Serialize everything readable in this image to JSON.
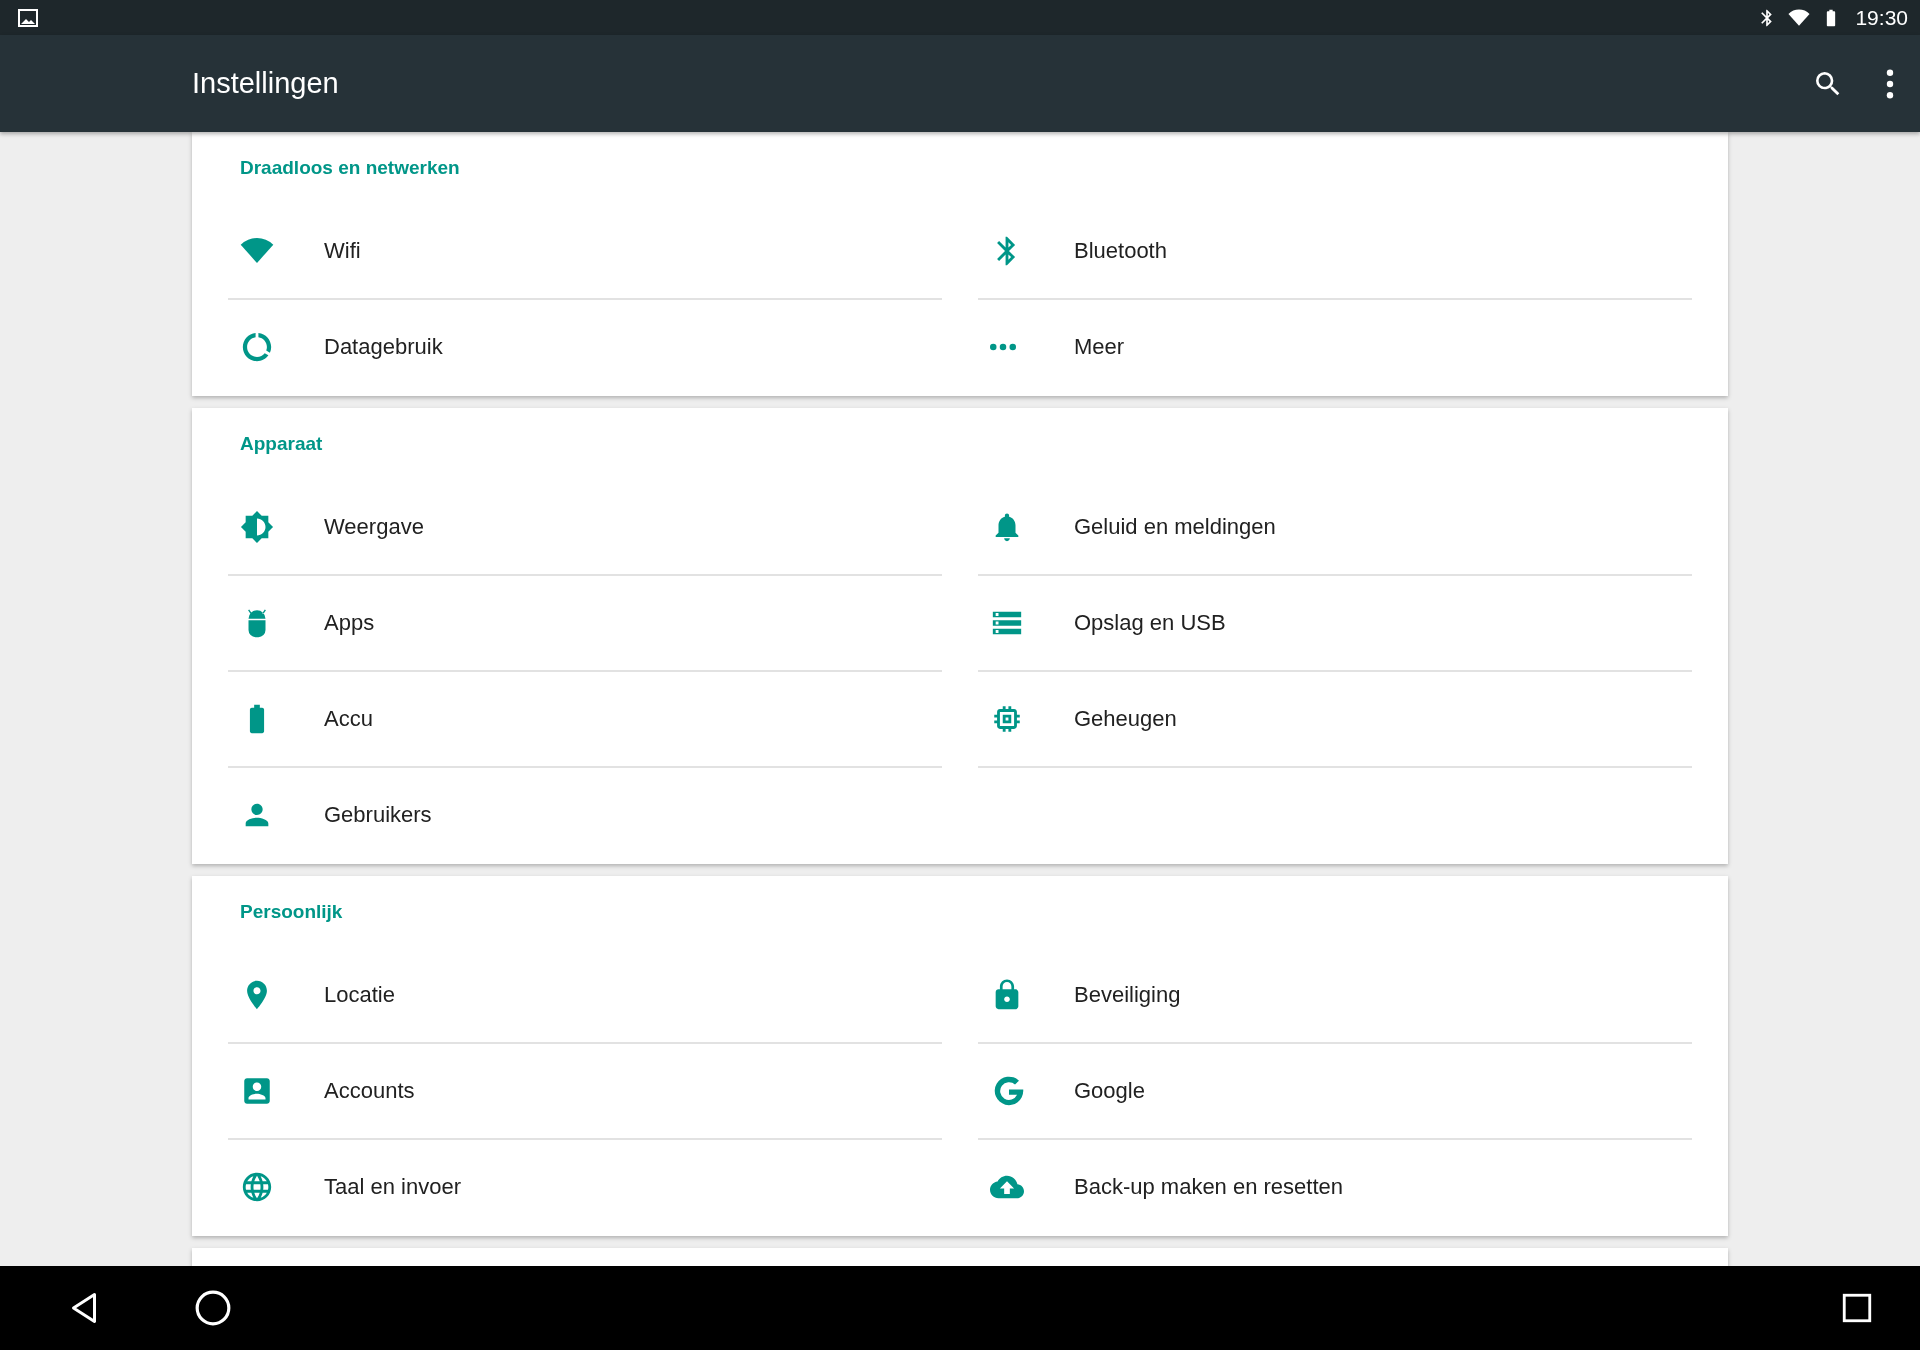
{
  "status_bar": {
    "time": "19:30"
  },
  "app_bar": {
    "title": "Instellingen"
  },
  "sections": [
    {
      "title": "Draadloos en netwerken",
      "items": [
        {
          "label": "Wifi",
          "kind": "wifi"
        },
        {
          "label": "Bluetooth",
          "kind": "bluetooth"
        },
        {
          "label": "Datagebruik",
          "kind": "data"
        },
        {
          "label": "Meer",
          "kind": "more"
        }
      ]
    },
    {
      "title": "Apparaat",
      "items": [
        {
          "label": "Weergave",
          "kind": "display"
        },
        {
          "label": "Geluid en meldingen",
          "kind": "sound"
        },
        {
          "label": "Apps",
          "kind": "apps"
        },
        {
          "label": "Opslag en USB",
          "kind": "storage"
        },
        {
          "label": "Accu",
          "kind": "battery"
        },
        {
          "label": "Geheugen",
          "kind": "memory"
        },
        {
          "label": "Gebruikers",
          "kind": "users"
        }
      ]
    },
    {
      "title": "Persoonlijk",
      "items": [
        {
          "label": "Locatie",
          "kind": "location"
        },
        {
          "label": "Beveiliging",
          "kind": "security"
        },
        {
          "label": "Accounts",
          "kind": "accounts"
        },
        {
          "label": "Google",
          "kind": "google"
        },
        {
          "label": "Taal en invoer",
          "kind": "language"
        },
        {
          "label": "Back-up maken en resetten",
          "kind": "backup"
        }
      ]
    }
  ]
}
